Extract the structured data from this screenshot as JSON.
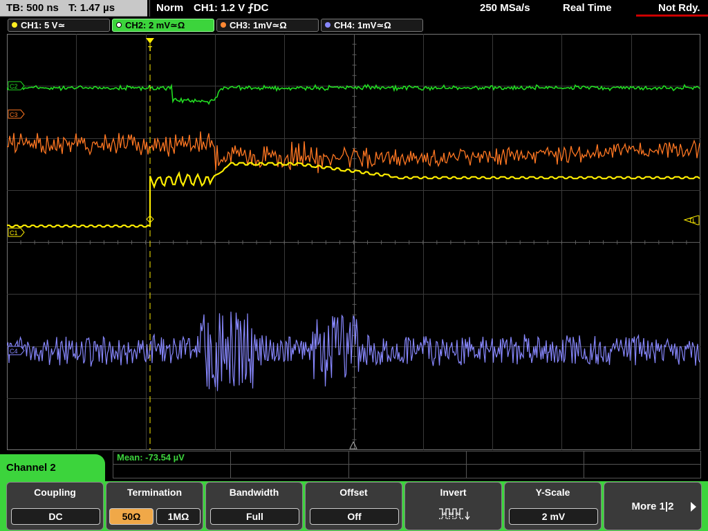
{
  "status": {
    "timebase": "TB: 500 ns",
    "trigger_time": "T: 1.47 µs",
    "mode": "Norm",
    "trigger": "CH1: 1.2 V ⨍DC",
    "sample_rate": "250 MSa/s",
    "acq_mode": "Real Time",
    "trigger_state": "Not Rdy."
  },
  "channels": [
    {
      "label": "CH1: 5 V≃",
      "color": "#ffee22"
    },
    {
      "label": "CH2: 2 mV≃Ω",
      "color": "#33dd33"
    },
    {
      "label": "CH3: 1mV≃Ω",
      "color": "#ff8833"
    },
    {
      "label": "CH4: 1mV≃Ω",
      "color": "#8888ff"
    }
  ],
  "markers": {
    "c2": "C2",
    "c3": "C3",
    "c1": "C1",
    "c4": "C4",
    "tl": "TL",
    "trigger": "T"
  },
  "measurement": {
    "mean": "Mean: -73.54 µV"
  },
  "menu": {
    "title": "Channel 2",
    "coupling": {
      "label": "Coupling",
      "value": "DC"
    },
    "termination": {
      "label": "Termination",
      "opt1": "50Ω",
      "opt2": "1MΩ",
      "selected": "50Ω"
    },
    "bandwidth": {
      "label": "Bandwidth",
      "value": "Full"
    },
    "offset": {
      "label": "Offset",
      "value": "Off"
    },
    "invert": {
      "label": "Invert",
      "icon": "invert-wave-icon"
    },
    "yscale": {
      "label": "Y-Scale",
      "value": "2 mV"
    },
    "more": "More 1|2"
  }
}
